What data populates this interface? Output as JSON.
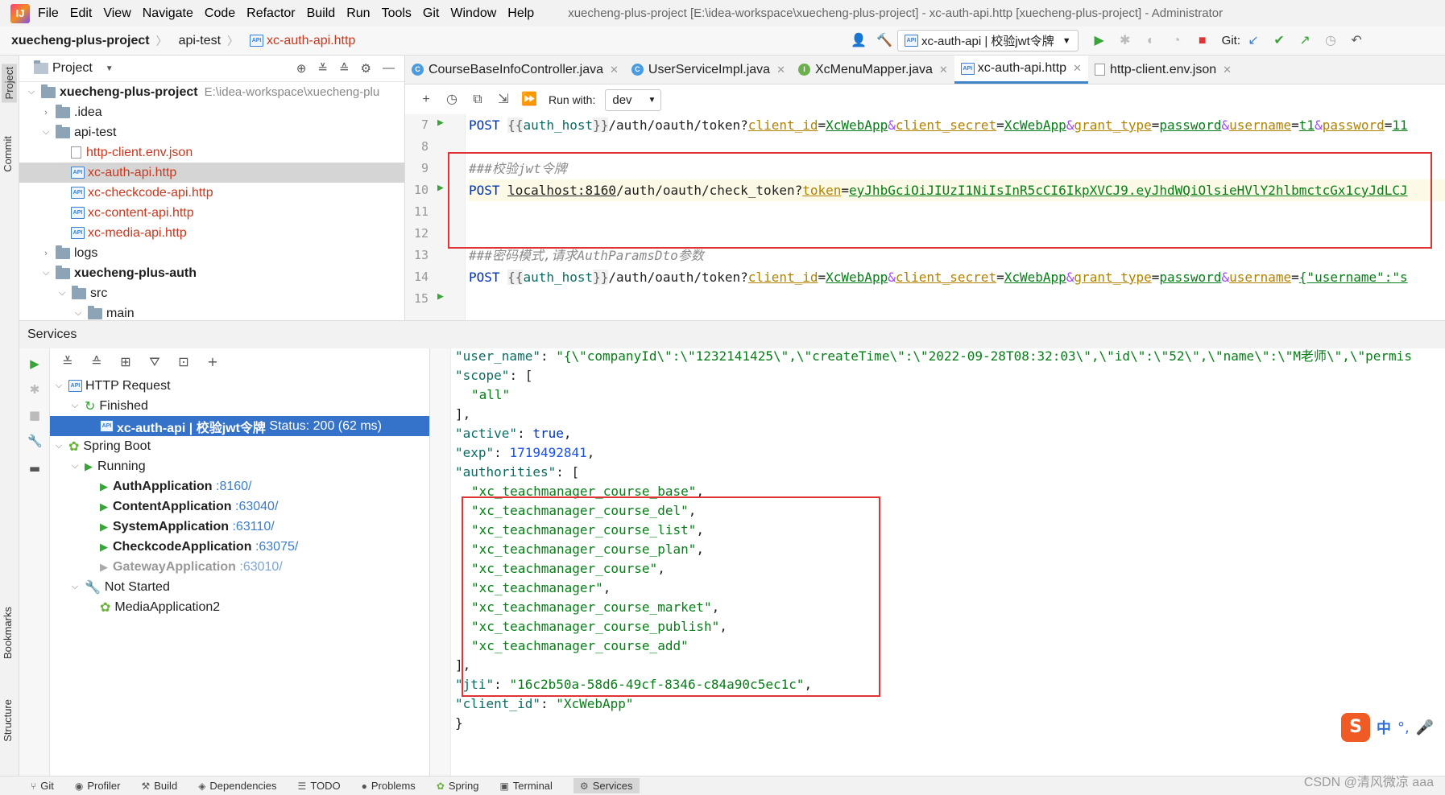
{
  "menubar": {
    "logo": "IJ",
    "items": [
      "File",
      "Edit",
      "View",
      "Navigate",
      "Code",
      "Refactor",
      "Build",
      "Run",
      "Tools",
      "Git",
      "Window",
      "Help"
    ],
    "window_title": "xuecheng-plus-project [E:\\idea-workspace\\xuecheng-plus-project] - xc-auth-api.http [xuecheng-plus-project] - Administrator"
  },
  "navbar": {
    "breadcrumbs": [
      "xuecheng-plus-project",
      "api-test",
      "xc-auth-api.http"
    ],
    "run_config": "xc-auth-api | 校验jwt令牌",
    "git_label": "Git:"
  },
  "left_strip": {
    "project": "Project",
    "commit": "Commit",
    "bookmarks": "Bookmarks",
    "structure": "Structure"
  },
  "project_panel": {
    "title": "Project",
    "root_name": "xuecheng-plus-project",
    "root_path": "E:\\idea-workspace\\xuecheng-plu",
    "idea": ".idea",
    "api_test": "api-test",
    "files": [
      "http-client.env.json",
      "xc-auth-api.http",
      "xc-checkcode-api.http",
      "xc-content-api.http",
      "xc-media-api.http"
    ],
    "logs": "logs",
    "auth": "xuecheng-plus-auth",
    "src": "src",
    "main": "main"
  },
  "editor_tabs": [
    {
      "label": "CourseBaseInfoController.java",
      "icon": "class"
    },
    {
      "label": "UserServiceImpl.java",
      "icon": "class"
    },
    {
      "label": "XcMenuMapper.java",
      "icon": "interface"
    },
    {
      "label": "xc-auth-api.http",
      "icon": "api"
    },
    {
      "label": "http-client.env.json",
      "icon": "json"
    }
  ],
  "http_toolbar": {
    "run_with": "Run with:",
    "env": "dev"
  },
  "editor": {
    "line_numbers": [
      "7",
      "8",
      "9",
      "10",
      "11",
      "12",
      "13",
      "14",
      "15"
    ],
    "l7": {
      "method": "POST",
      "open": "{{",
      "var": "auth_host",
      "close": "}}",
      "path": "/auth/oauth/token?",
      "p1": "client_id",
      "v1": "XcWebApp",
      "p2": "client_secret",
      "v2": "XcWebApp",
      "p3": "grant_type",
      "v3": "password",
      "p4": "username",
      "v4": "t1",
      "p5": "password",
      "v5": "11"
    },
    "l9": "###校验jwt令牌",
    "l10": {
      "method": "POST",
      "host": "localhost:8160",
      "path": "/auth/oauth/check_token?",
      "p1": "token",
      "v1": "eyJhbGciOiJIUzI1NiIsInR5cCI6IkpXVCJ9.eyJhdWQiOlsieHVlY2hlbmctcGx1cyJdLCJ"
    },
    "l14": "###密码模式,请求AuthParamsDto参数",
    "l15": {
      "method": "POST",
      "open": "{{",
      "var": "auth_host",
      "close": "}}",
      "path": "/auth/oauth/token?",
      "p1": "client_id",
      "v1": "XcWebApp",
      "p2": "client_secret",
      "v2": "XcWebApp",
      "p3": "grant_type",
      "v3": "password",
      "p4": "username",
      "v4": "{\"username\":\"s"
    }
  },
  "services": {
    "title": "Services",
    "http_request": "HTTP Request",
    "finished": "Finished",
    "selected": "xc-auth-api | 校验jwt令牌",
    "selected_status": "Status: 200 (62 ms)",
    "spring_boot": "Spring Boot",
    "running": "Running",
    "apps": [
      {
        "name": "AuthApplication",
        "port": ":8160/"
      },
      {
        "name": "ContentApplication",
        "port": ":63040/"
      },
      {
        "name": "SystemApplication",
        "port": ":63110/"
      },
      {
        "name": "CheckcodeApplication",
        "port": ":63075/"
      },
      {
        "name": "GatewayApplication",
        "port": ":63010/"
      }
    ],
    "not_started": "Not Started",
    "media": "MediaApplication2"
  },
  "response": {
    "user_name_key": "\"user_name\"",
    "user_name_val": "\"{\\\"companyId\\\":\\\"1232141425\\\",\\\"createTime\\\":\\\"2022-09-28T08:32:03\\\",\\\"id\\\":\\\"52\\\",\\\"name\\\":\\\"M老师\\\",\\\"permis",
    "scope_key": "\"scope\"",
    "scope_val": "\"all\"",
    "active_key": "\"active\"",
    "active_val": "true",
    "exp_key": "\"exp\"",
    "exp_val": "1719492841",
    "authorities_key": "\"authorities\"",
    "authorities": [
      "\"xc_teachmanager_course_base\"",
      "\"xc_teachmanager_course_del\"",
      "\"xc_teachmanager_course_list\"",
      "\"xc_teachmanager_course_plan\"",
      "\"xc_teachmanager_course\"",
      "\"xc_teachmanager\"",
      "\"xc_teachmanager_course_market\"",
      "\"xc_teachmanager_course_publish\"",
      "\"xc_teachmanager_course_add\""
    ],
    "jti_key": "\"jti\"",
    "jti_val": "\"16c2b50a-58d6-49cf-8346-c84a90c5ec1c\"",
    "client_id_key": "\"client_id\"",
    "client_id_val": "\"XcWebApp\""
  },
  "statusbar": [
    "Git",
    "Profiler",
    "Build",
    "Dependencies",
    "TODO",
    "Problems",
    "Spring",
    "Terminal",
    "Services"
  ],
  "ime": {
    "lang": "中",
    "punct": "°,"
  },
  "watermark": "CSDN @清风微凉 aaa"
}
